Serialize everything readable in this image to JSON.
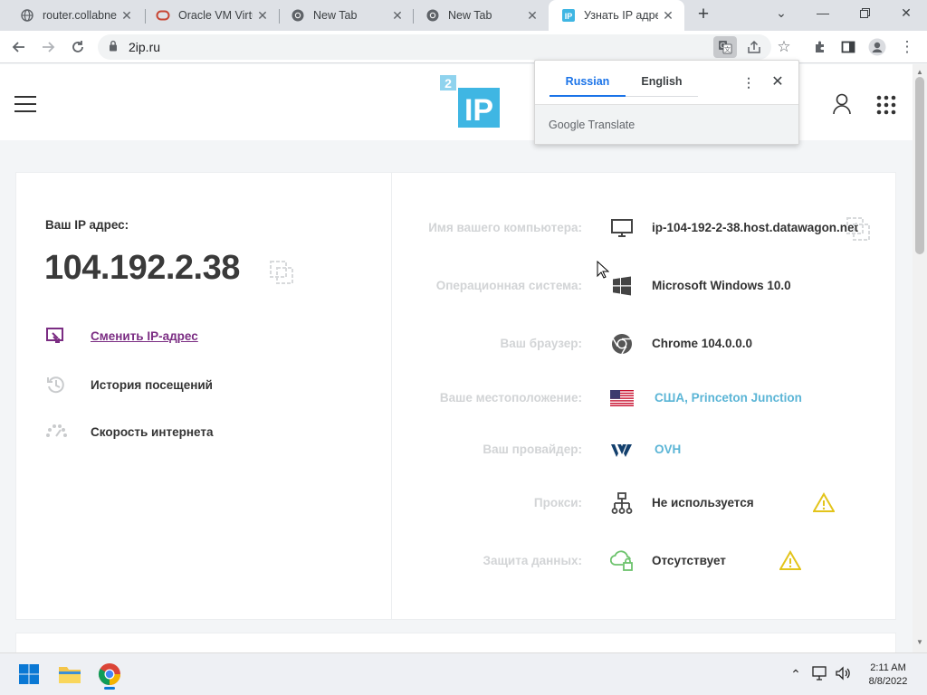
{
  "browser": {
    "tabs": [
      {
        "label": "router.collabnet",
        "icon": "globe-icon"
      },
      {
        "label": "Oracle VM Virtu",
        "icon": "oracle-icon"
      },
      {
        "label": "New Tab",
        "icon": "chrome-icon"
      },
      {
        "label": "New Tab",
        "icon": "chrome-icon"
      },
      {
        "label": "Узнать IP адрес",
        "icon": "2ip-favicon",
        "active": true
      }
    ],
    "new_tab": "+",
    "url": "2ip.ru",
    "window_controls": [
      "minimize",
      "restore",
      "close"
    ]
  },
  "translate_popup": {
    "tab_source": "Russian",
    "tab_target": "English",
    "menu": "⋮",
    "close": "✕",
    "footer": "Google Translate"
  },
  "site": {
    "logo": {
      "badge": "2",
      "text": "IP"
    },
    "ip_label": "Ваш IP адрес:",
    "ip_value": "104.192.2.38",
    "actions": [
      {
        "label": "Сменить IP-адрес",
        "icon": "switch-ip-icon"
      },
      {
        "label": "История посещений",
        "icon": "history-icon"
      },
      {
        "label": "Скорость интернета",
        "icon": "speed-icon"
      }
    ],
    "info": [
      {
        "key": "Имя вашего компьютера:",
        "value": "ip-104-192-2-38.host.datawagon.net",
        "icon": "monitor-icon"
      },
      {
        "key": "Операционная система:",
        "value": "Microsoft Windows 10.0",
        "icon": "windows-icon"
      },
      {
        "key": "Ваш браузер:",
        "value": "Chrome 104.0.0.0",
        "icon": "chrome-icon"
      },
      {
        "key": "Ваше местоположение:",
        "value": "США, Princeton Junction",
        "icon": "us-flag-icon"
      },
      {
        "key": "Ваш провайдер:",
        "value": "OVH",
        "icon": "ovh-logo-icon"
      },
      {
        "key": "Прокси:",
        "value": "Не используется",
        "icon": "network-icon"
      },
      {
        "key": "Защита данных:",
        "value": "Отсутствует",
        "icon": "cloud-lock-icon"
      }
    ]
  },
  "taskbar": {
    "time": "2:11 AM",
    "date": "8/8/2022",
    "apps": [
      "start-icon",
      "file-explorer-icon",
      "chrome-icon"
    ]
  },
  "colors": {
    "accent": "#5bb5d6",
    "link": "#7b2d83",
    "warning": "#e3c41b",
    "logo": "#3fb6e3"
  }
}
